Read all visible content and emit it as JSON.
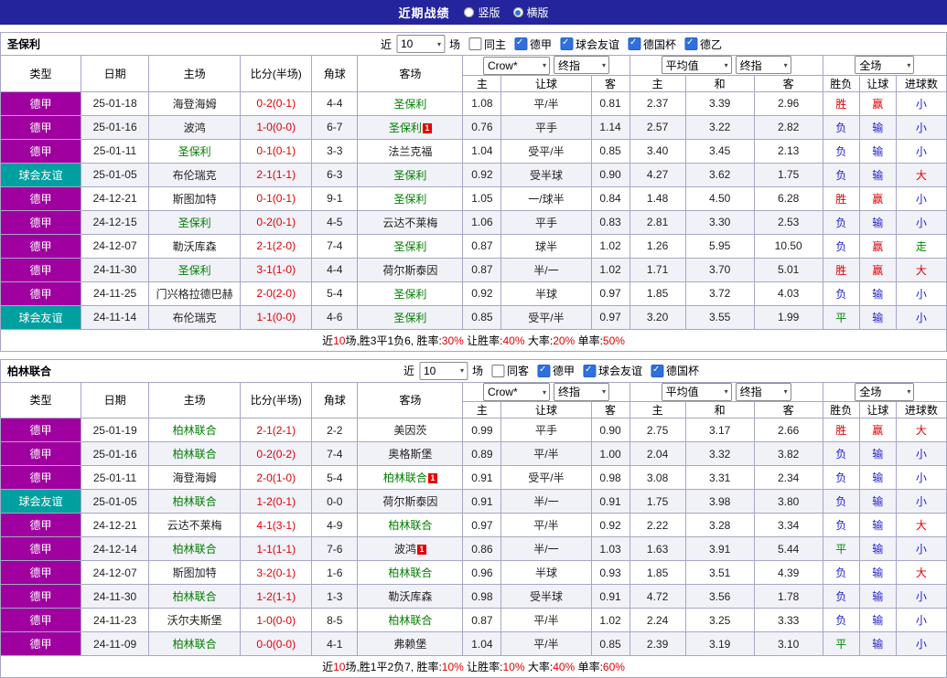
{
  "topbar": {
    "title": "近期战绩",
    "view_options": [
      {
        "label": "竖版",
        "selected": false
      },
      {
        "label": "横版",
        "selected": true
      }
    ]
  },
  "controls": {
    "near": "近",
    "count": "10",
    "games": "场"
  },
  "table_header": {
    "type": "类型",
    "date": "日期",
    "home": "主场",
    "score": "比分(半场)",
    "corner": "角球",
    "away": "客场",
    "asian_source": "Crow*",
    "asian_time": "终指",
    "euro_source": "平均值",
    "euro_time": "终指",
    "scope": "全场",
    "sub": [
      "主",
      "让球",
      "客",
      "主",
      "和",
      "客",
      "胜负",
      "让球",
      "进球数"
    ]
  },
  "colors": {
    "league_purple": "#A000A0",
    "league_teal": "#00A0A0",
    "team_green": "#008000",
    "red": "#E10000",
    "blue": "#2323CC",
    "green": "#008800",
    "topbar_bg": "#24249C"
  },
  "sections": [
    {
      "team": "圣保利",
      "same_label": "同主",
      "same_checked": false,
      "leagues": [
        "德甲",
        "球会友谊",
        "德国杯",
        "德乙"
      ],
      "rows": [
        {
          "type": "德甲",
          "lg": "p",
          "date": "25-01-18",
          "home": {
            "name": "海登海姆",
            "green": false,
            "rc": false
          },
          "score": "0-2(0-1)",
          "corner": "4-4",
          "away": {
            "name": "圣保利",
            "green": true,
            "rc": false
          },
          "asian": [
            "1.08",
            "平/半",
            "0.81"
          ],
          "euro": [
            "2.37",
            "3.39",
            "2.96"
          ],
          "result": [
            [
              "胜",
              "r"
            ],
            [
              "赢",
              "r"
            ],
            [
              "小",
              "b"
            ]
          ]
        },
        {
          "type": "德甲",
          "lg": "p",
          "date": "25-01-16",
          "home": {
            "name": "波鸿",
            "green": false,
            "rc": false
          },
          "score": "1-0(0-0)",
          "corner": "6-7",
          "away": {
            "name": "圣保利",
            "green": true,
            "rc": true
          },
          "asian": [
            "0.76",
            "平手",
            "1.14"
          ],
          "euro": [
            "2.57",
            "3.22",
            "2.82"
          ],
          "result": [
            [
              "负",
              "b"
            ],
            [
              "输",
              "b"
            ],
            [
              "小",
              "b"
            ]
          ]
        },
        {
          "type": "德甲",
          "lg": "p",
          "date": "25-01-11",
          "home": {
            "name": "圣保利",
            "green": true,
            "rc": false
          },
          "score": "0-1(0-1)",
          "corner": "3-3",
          "away": {
            "name": "法兰克福",
            "green": false,
            "rc": false
          },
          "asian": [
            "1.04",
            "受平/半",
            "0.85"
          ],
          "euro": [
            "3.40",
            "3.45",
            "2.13"
          ],
          "result": [
            [
              "负",
              "b"
            ],
            [
              "输",
              "b"
            ],
            [
              "小",
              "b"
            ]
          ]
        },
        {
          "type": "球会友谊",
          "lg": "t",
          "date": "25-01-05",
          "home": {
            "name": "布伦瑞克",
            "green": false,
            "rc": false
          },
          "score": "2-1(1-1)",
          "corner": "6-3",
          "away": {
            "name": "圣保利",
            "green": true,
            "rc": false
          },
          "asian": [
            "0.92",
            "受半球",
            "0.90"
          ],
          "euro": [
            "4.27",
            "3.62",
            "1.75"
          ],
          "result": [
            [
              "负",
              "b"
            ],
            [
              "输",
              "b"
            ],
            [
              "大",
              "r"
            ]
          ]
        },
        {
          "type": "德甲",
          "lg": "p",
          "date": "24-12-21",
          "home": {
            "name": "斯图加特",
            "green": false,
            "rc": false
          },
          "score": "0-1(0-1)",
          "corner": "9-1",
          "away": {
            "name": "圣保利",
            "green": true,
            "rc": false
          },
          "asian": [
            "1.05",
            "一/球半",
            "0.84"
          ],
          "euro": [
            "1.48",
            "4.50",
            "6.28"
          ],
          "result": [
            [
              "胜",
              "r"
            ],
            [
              "赢",
              "r"
            ],
            [
              "小",
              "b"
            ]
          ]
        },
        {
          "type": "德甲",
          "lg": "p",
          "date": "24-12-15",
          "home": {
            "name": "圣保利",
            "green": true,
            "rc": false
          },
          "score": "0-2(0-1)",
          "corner": "4-5",
          "away": {
            "name": "云达不莱梅",
            "green": false,
            "rc": false
          },
          "asian": [
            "1.06",
            "平手",
            "0.83"
          ],
          "euro": [
            "2.81",
            "3.30",
            "2.53"
          ],
          "result": [
            [
              "负",
              "b"
            ],
            [
              "输",
              "b"
            ],
            [
              "小",
              "b"
            ]
          ]
        },
        {
          "type": "德甲",
          "lg": "p",
          "date": "24-12-07",
          "home": {
            "name": "勒沃库森",
            "green": false,
            "rc": false
          },
          "score": "2-1(2-0)",
          "corner": "7-4",
          "away": {
            "name": "圣保利",
            "green": true,
            "rc": false
          },
          "asian": [
            "0.87",
            "球半",
            "1.02"
          ],
          "euro": [
            "1.26",
            "5.95",
            "10.50"
          ],
          "result": [
            [
              "负",
              "b"
            ],
            [
              "赢",
              "r"
            ],
            [
              "走",
              "g"
            ]
          ]
        },
        {
          "type": "德甲",
          "lg": "p",
          "date": "24-11-30",
          "home": {
            "name": "圣保利",
            "green": true,
            "rc": false
          },
          "score": "3-1(1-0)",
          "corner": "4-4",
          "away": {
            "name": "荷尔斯泰因",
            "green": false,
            "rc": false
          },
          "asian": [
            "0.87",
            "半/一",
            "1.02"
          ],
          "euro": [
            "1.71",
            "3.70",
            "5.01"
          ],
          "result": [
            [
              "胜",
              "r"
            ],
            [
              "赢",
              "r"
            ],
            [
              "大",
              "r"
            ]
          ]
        },
        {
          "type": "德甲",
          "lg": "p",
          "date": "24-11-25",
          "home": {
            "name": "门兴格拉德巴赫",
            "green": false,
            "rc": false
          },
          "score": "2-0(2-0)",
          "corner": "5-4",
          "away": {
            "name": "圣保利",
            "green": true,
            "rc": false
          },
          "asian": [
            "0.92",
            "半球",
            "0.97"
          ],
          "euro": [
            "1.85",
            "3.72",
            "4.03"
          ],
          "result": [
            [
              "负",
              "b"
            ],
            [
              "输",
              "b"
            ],
            [
              "小",
              "b"
            ]
          ]
        },
        {
          "type": "球会友谊",
          "lg": "t",
          "date": "24-11-14",
          "home": {
            "name": "布伦瑞克",
            "green": false,
            "rc": false
          },
          "score": "1-1(0-0)",
          "corner": "4-6",
          "away": {
            "name": "圣保利",
            "green": true,
            "rc": false
          },
          "asian": [
            "0.85",
            "受平/半",
            "0.97"
          ],
          "euro": [
            "3.20",
            "3.55",
            "1.99"
          ],
          "result": [
            [
              "平",
              "g"
            ],
            [
              "输",
              "b"
            ],
            [
              "小",
              "b"
            ]
          ]
        }
      ],
      "footer": [
        [
          "近",
          "k"
        ],
        [
          "10",
          "r"
        ],
        [
          "场,胜3平1负6, 胜率:",
          "k"
        ],
        [
          "30%",
          "r"
        ],
        [
          " 让胜率:",
          "k"
        ],
        [
          "40%",
          "r"
        ],
        [
          " 大率:",
          "k"
        ],
        [
          "20%",
          "r"
        ],
        [
          " 单率:",
          "k"
        ],
        [
          "50%",
          "r"
        ]
      ]
    },
    {
      "team": "柏林联合",
      "same_label": "同客",
      "same_checked": false,
      "leagues": [
        "德甲",
        "球会友谊",
        "德国杯"
      ],
      "rows": [
        {
          "type": "德甲",
          "lg": "p",
          "date": "25-01-19",
          "home": {
            "name": "柏林联合",
            "green": true,
            "rc": false
          },
          "score": "2-1(2-1)",
          "corner": "2-2",
          "away": {
            "name": "美因茨",
            "green": false,
            "rc": false
          },
          "asian": [
            "0.99",
            "平手",
            "0.90"
          ],
          "euro": [
            "2.75",
            "3.17",
            "2.66"
          ],
          "result": [
            [
              "胜",
              "r"
            ],
            [
              "赢",
              "r"
            ],
            [
              "大",
              "r"
            ]
          ]
        },
        {
          "type": "德甲",
          "lg": "p",
          "date": "25-01-16",
          "home": {
            "name": "柏林联合",
            "green": true,
            "rc": false
          },
          "score": "0-2(0-2)",
          "corner": "7-4",
          "away": {
            "name": "奥格斯堡",
            "green": false,
            "rc": false
          },
          "asian": [
            "0.89",
            "平/半",
            "1.00"
          ],
          "euro": [
            "2.04",
            "3.32",
            "3.82"
          ],
          "result": [
            [
              "负",
              "b"
            ],
            [
              "输",
              "b"
            ],
            [
              "小",
              "b"
            ]
          ]
        },
        {
          "type": "德甲",
          "lg": "p",
          "date": "25-01-11",
          "home": {
            "name": "海登海姆",
            "green": false,
            "rc": false
          },
          "score": "2-0(1-0)",
          "corner": "5-4",
          "away": {
            "name": "柏林联合",
            "green": true,
            "rc": true
          },
          "asian": [
            "0.91",
            "受平/半",
            "0.98"
          ],
          "euro": [
            "3.08",
            "3.31",
            "2.34"
          ],
          "result": [
            [
              "负",
              "b"
            ],
            [
              "输",
              "b"
            ],
            [
              "小",
              "b"
            ]
          ]
        },
        {
          "type": "球会友谊",
          "lg": "t",
          "date": "25-01-05",
          "home": {
            "name": "柏林联合",
            "green": true,
            "rc": false
          },
          "score": "1-2(0-1)",
          "corner": "0-0",
          "away": {
            "name": "荷尔斯泰因",
            "green": false,
            "rc": false
          },
          "asian": [
            "0.91",
            "半/一",
            "0.91"
          ],
          "euro": [
            "1.75",
            "3.98",
            "3.80"
          ],
          "result": [
            [
              "负",
              "b"
            ],
            [
              "输",
              "b"
            ],
            [
              "小",
              "b"
            ]
          ]
        },
        {
          "type": "德甲",
          "lg": "p",
          "date": "24-12-21",
          "home": {
            "name": "云达不莱梅",
            "green": false,
            "rc": false
          },
          "score": "4-1(3-1)",
          "corner": "4-9",
          "away": {
            "name": "柏林联合",
            "green": true,
            "rc": false
          },
          "asian": [
            "0.97",
            "平/半",
            "0.92"
          ],
          "euro": [
            "2.22",
            "3.28",
            "3.34"
          ],
          "result": [
            [
              "负",
              "b"
            ],
            [
              "输",
              "b"
            ],
            [
              "大",
              "r"
            ]
          ]
        },
        {
          "type": "德甲",
          "lg": "p",
          "date": "24-12-14",
          "home": {
            "name": "柏林联合",
            "green": true,
            "rc": false
          },
          "score": "1-1(1-1)",
          "corner": "7-6",
          "away": {
            "name": "波鸿",
            "green": false,
            "rc": true
          },
          "asian": [
            "0.86",
            "半/一",
            "1.03"
          ],
          "euro": [
            "1.63",
            "3.91",
            "5.44"
          ],
          "result": [
            [
              "平",
              "g"
            ],
            [
              "输",
              "b"
            ],
            [
              "小",
              "b"
            ]
          ]
        },
        {
          "type": "德甲",
          "lg": "p",
          "date": "24-12-07",
          "home": {
            "name": "斯图加特",
            "green": false,
            "rc": false
          },
          "score": "3-2(0-1)",
          "corner": "1-6",
          "away": {
            "name": "柏林联合",
            "green": true,
            "rc": false
          },
          "asian": [
            "0.96",
            "半球",
            "0.93"
          ],
          "euro": [
            "1.85",
            "3.51",
            "4.39"
          ],
          "result": [
            [
              "负",
              "b"
            ],
            [
              "输",
              "b"
            ],
            [
              "大",
              "r"
            ]
          ]
        },
        {
          "type": "德甲",
          "lg": "p",
          "date": "24-11-30",
          "home": {
            "name": "柏林联合",
            "green": true,
            "rc": false
          },
          "score": "1-2(1-1)",
          "corner": "1-3",
          "away": {
            "name": "勒沃库森",
            "green": false,
            "rc": false
          },
          "asian": [
            "0.98",
            "受半球",
            "0.91"
          ],
          "euro": [
            "4.72",
            "3.56",
            "1.78"
          ],
          "result": [
            [
              "负",
              "b"
            ],
            [
              "输",
              "b"
            ],
            [
              "小",
              "b"
            ]
          ]
        },
        {
          "type": "德甲",
          "lg": "p",
          "date": "24-11-23",
          "home": {
            "name": "沃尔夫斯堡",
            "green": false,
            "rc": false
          },
          "score": "1-0(0-0)",
          "corner": "8-5",
          "away": {
            "name": "柏林联合",
            "green": true,
            "rc": false
          },
          "asian": [
            "0.87",
            "平/半",
            "1.02"
          ],
          "euro": [
            "2.24",
            "3.25",
            "3.33"
          ],
          "result": [
            [
              "负",
              "b"
            ],
            [
              "输",
              "b"
            ],
            [
              "小",
              "b"
            ]
          ]
        },
        {
          "type": "德甲",
          "lg": "p",
          "date": "24-11-09",
          "home": {
            "name": "柏林联合",
            "green": true,
            "rc": false
          },
          "score": "0-0(0-0)",
          "corner": "4-1",
          "away": {
            "name": "弗赖堡",
            "green": false,
            "rc": false
          },
          "asian": [
            "1.04",
            "平/半",
            "0.85"
          ],
          "euro": [
            "2.39",
            "3.19",
            "3.10"
          ],
          "result": [
            [
              "平",
              "g"
            ],
            [
              "输",
              "b"
            ],
            [
              "小",
              "b"
            ]
          ]
        }
      ],
      "footer": [
        [
          "近",
          "k"
        ],
        [
          "10",
          "r"
        ],
        [
          "场,胜1平2负7, 胜率:",
          "k"
        ],
        [
          "10%",
          "r"
        ],
        [
          " 让胜率:",
          "k"
        ],
        [
          "10%",
          "r"
        ],
        [
          " 大率:",
          "k"
        ],
        [
          "40%",
          "r"
        ],
        [
          " 单率:",
          "k"
        ],
        [
          "60%",
          "r"
        ]
      ]
    }
  ]
}
